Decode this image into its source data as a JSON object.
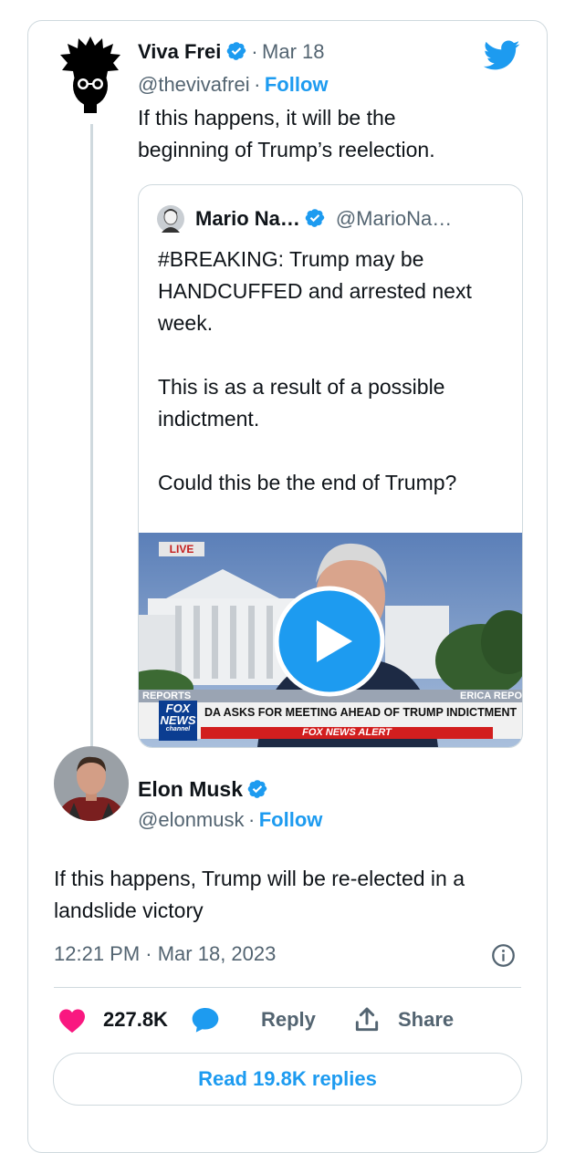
{
  "original_tweet": {
    "display_name": "Viva Frei",
    "date": "Mar 18",
    "handle": "@thevivafrei",
    "separator": "·",
    "follow_label": "Follow",
    "text_line1": "If this happens, it will be the",
    "text_line2": "beginning of Trump’s reelection."
  },
  "quoted_tweet": {
    "display_name": "Mario Na…",
    "handle": "@MarioNa…",
    "lines": [
      "#BREAKING: Trump may be",
      "HANDCUFFED and arrested next",
      "week.",
      "This is as a result of a possible",
      "indictment.",
      "Could this be the end of Trump?"
    ],
    "video": {
      "live_label": "LIVE",
      "reports_label": "REPORTS",
      "right_label": "ERICA REPO",
      "network_logo_line1": "FOX",
      "network_logo_line2": "NEWS",
      "network_logo_line3": "channel",
      "headline": "DA ASKS FOR MEETING AHEAD OF TRUMP INDICTMENT",
      "alert_label": "FOX NEWS ALERT"
    }
  },
  "reply_tweet": {
    "display_name": "Elon Musk",
    "handle": "@elonmusk",
    "separator": "·",
    "follow_label": "Follow",
    "text_line1": "If this happens, Trump will be re-elected in a",
    "text_line2": "landslide victory",
    "timestamp": "12:21 PM · Mar 18, 2023"
  },
  "actions": {
    "likes": "227.8K",
    "reply_label": "Reply",
    "share_label": "Share",
    "read_replies_label": "Read 19.8K replies"
  },
  "icons": {
    "twitter_logo": "twitter-bird-icon",
    "verified": "verified-badge-icon",
    "like": "heart-icon",
    "reply": "speech-bubble-icon",
    "share": "share-upload-icon",
    "info": "info-icon",
    "play": "play-icon"
  },
  "colors": {
    "brand_blue": "#1d9bf0",
    "like_pink": "#f91880",
    "muted_text": "#536471",
    "border": "#cfd9de"
  }
}
